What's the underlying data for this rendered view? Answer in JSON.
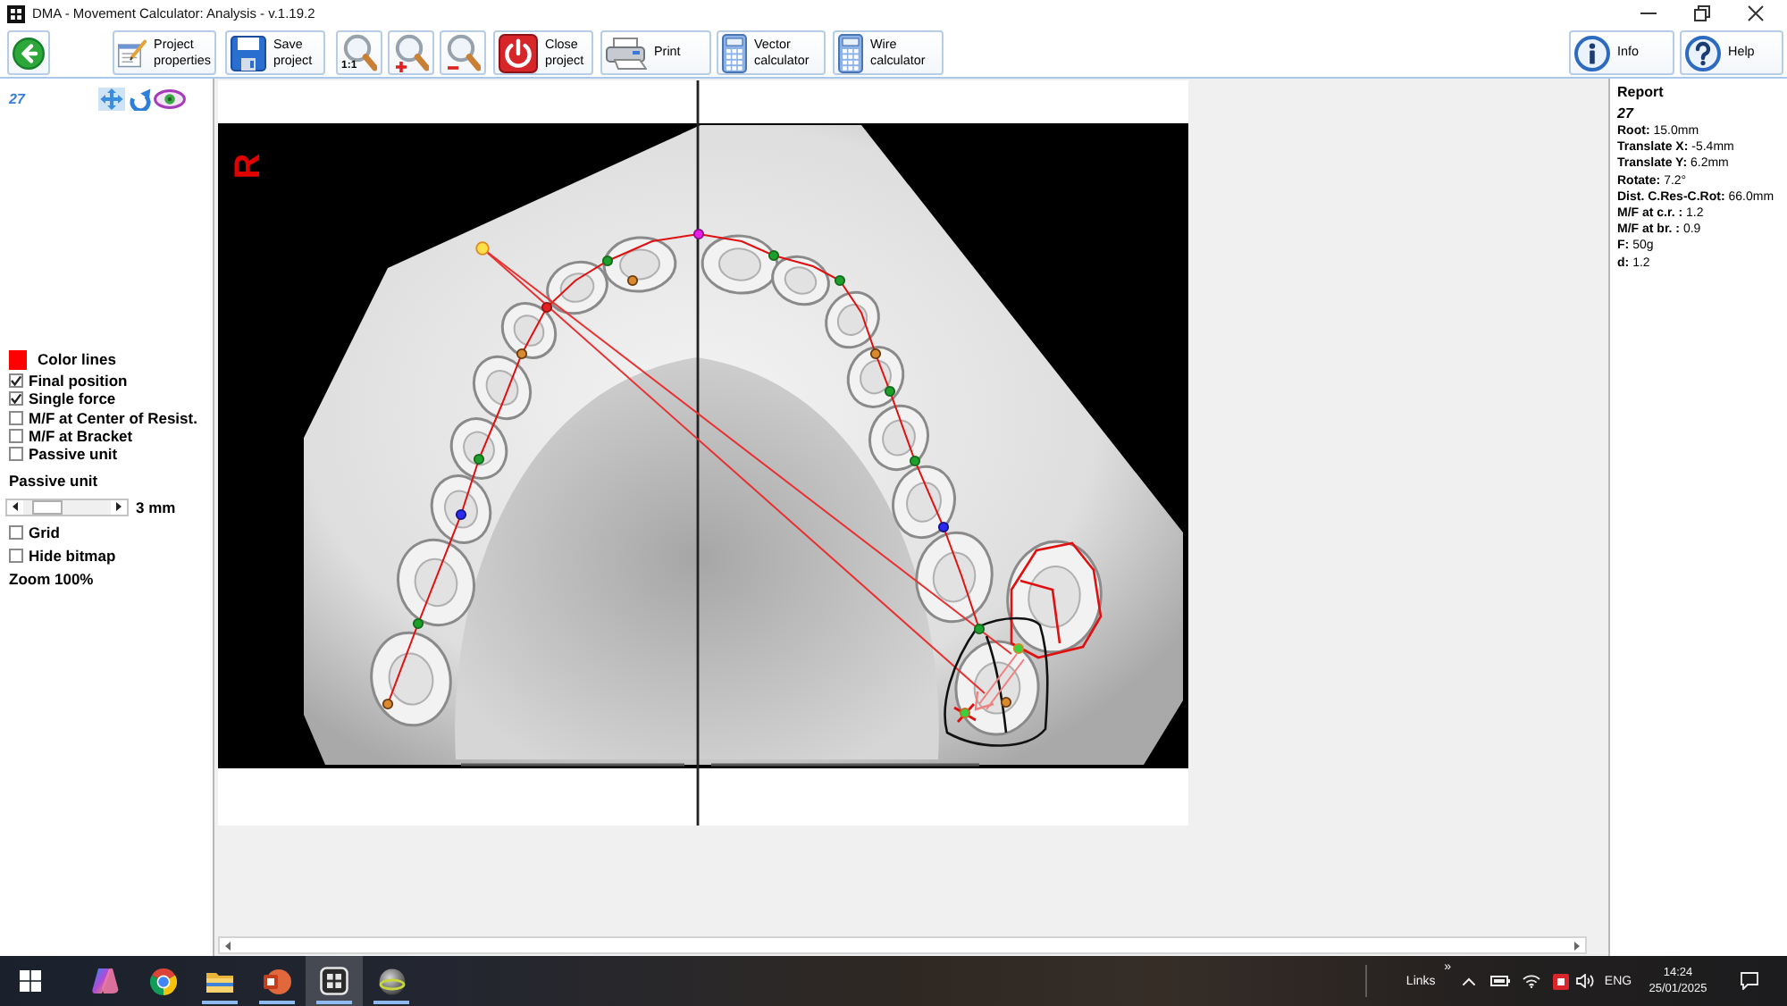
{
  "window": {
    "title": "DMA - Movement Calculator: Analysis - v.1.19.2"
  },
  "toolbar": {
    "buttons": [
      {
        "kind": "back"
      },
      {
        "kind": "properties",
        "label": [
          "Project",
          "properties"
        ]
      },
      {
        "kind": "save",
        "label": [
          "Save",
          "project"
        ]
      },
      {
        "kind": "zoom_actual",
        "caption": "1:1"
      },
      {
        "kind": "zoom_in"
      },
      {
        "kind": "zoom_out"
      },
      {
        "kind": "close",
        "label": [
          "Close",
          "project"
        ]
      },
      {
        "kind": "print",
        "label": [
          "Print"
        ]
      },
      {
        "kind": "vector",
        "label": [
          "Vector",
          "calculator"
        ]
      },
      {
        "kind": "wire",
        "label": [
          "Wire",
          "calculator"
        ]
      }
    ],
    "right_buttons": [
      {
        "kind": "info",
        "label": [
          "Info"
        ]
      },
      {
        "kind": "help",
        "label": [
          "Help"
        ]
      }
    ]
  },
  "left_panel": {
    "tooth_number": "27",
    "tools": [
      {
        "kind": "move",
        "selected": true
      },
      {
        "kind": "rotate",
        "selected": false
      },
      {
        "kind": "view",
        "selected": false
      }
    ],
    "color_lines": {
      "label": "Color lines"
    },
    "options": [
      {
        "label": "Final position",
        "checked": true
      },
      {
        "label": "Single force",
        "checked": true
      },
      {
        "label": "M/F at Center of Resist.",
        "checked": false
      },
      {
        "label": "M/F at Bracket",
        "checked": false
      },
      {
        "label": "Passive unit",
        "checked": false
      }
    ],
    "passive_unit": {
      "label": "Passive unit",
      "level": 0.15,
      "reading": "3 mm"
    },
    "display_options": [
      {
        "label": "Grid",
        "checked": false
      },
      {
        "label": "Hide bitmap",
        "checked": false
      }
    ],
    "zoom": "Zoom 100%"
  },
  "canvas": {
    "side_label": "R"
  },
  "report": {
    "title": "Report",
    "tooth_number": "27",
    "lines": [
      {
        "label": "Root:",
        "value": "15.0mm"
      },
      {
        "label": "Translate X:",
        "value": "-5.4mm"
      },
      {
        "label": "Translate Y:",
        "value": "6.2mm"
      },
      {
        "label": "Rotate:",
        "value": "7.2°"
      },
      {
        "label": "Dist. C.Res-C.Rot:",
        "value": "66.0mm"
      },
      {
        "label": "M/F at c.r. :",
        "value": "1.2"
      },
      {
        "label": "M/F at br. :",
        "value": "0.9"
      },
      {
        "label": "F:",
        "value": "50g"
      },
      {
        "label": "d:",
        "value": "1.2"
      }
    ]
  },
  "taskbar": {
    "apps": [
      {
        "kind": "assistant",
        "running": false,
        "selected": false
      },
      {
        "kind": "browser",
        "running": false,
        "selected": false
      },
      {
        "kind": "files",
        "running": true,
        "selected": false
      },
      {
        "kind": "slides",
        "running": true,
        "selected": false
      },
      {
        "kind": "task_view",
        "running": true,
        "selected": true
      },
      {
        "kind": "analysis",
        "running": true,
        "selected": false
      }
    ],
    "links": "Links",
    "links_more": "»",
    "language": "ENG",
    "time": "14:24",
    "date": "25/01/2025"
  }
}
